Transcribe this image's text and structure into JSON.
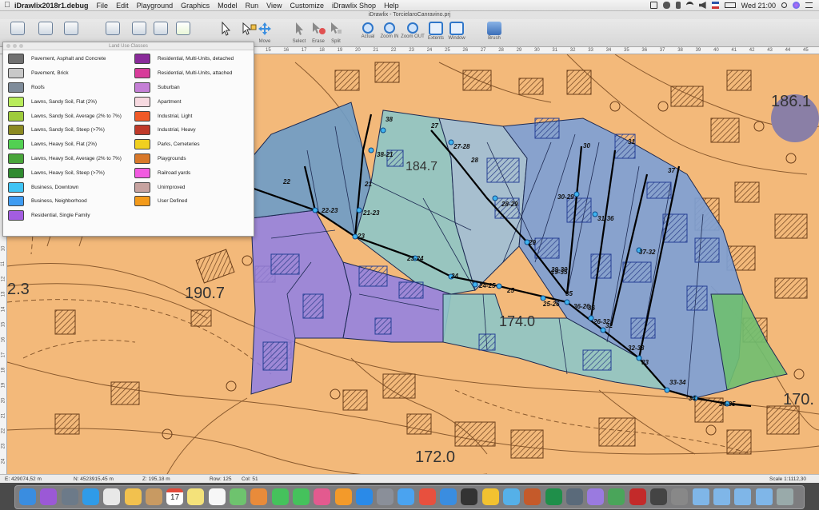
{
  "menubar": {
    "app_name": "iDrawlix2018r1.debug",
    "items": [
      "File",
      "Edit",
      "Playground",
      "Graphics",
      "Model",
      "Run",
      "View",
      "Customize",
      "iDrawlix Shop",
      "Help"
    ],
    "clock": "Wed 21:00"
  },
  "window": {
    "title": "iDrawlix - TorcielaroCanravino.prj"
  },
  "toolbar": {
    "buttons": [
      {
        "label": "",
        "icon": "document-icon"
      },
      {
        "label": "",
        "icon": "document-edit-icon"
      },
      {
        "label": "",
        "icon": "document-list-icon"
      },
      {
        "label": "",
        "icon": "image-icon"
      },
      {
        "label": "",
        "icon": "page-icon"
      },
      {
        "label": "",
        "icon": "page-alt-icon"
      },
      {
        "label": "",
        "icon": "chart-icon"
      },
      {
        "label": "",
        "icon": "pointer-icon"
      },
      {
        "label": "",
        "icon": "add-node-icon"
      },
      {
        "label": "Move",
        "icon": "move-icon"
      },
      {
        "label": "Select",
        "icon": "select-icon"
      },
      {
        "label": "Erase",
        "icon": "erase-icon"
      },
      {
        "label": "Split",
        "icon": "split-icon"
      },
      {
        "label": "Actual",
        "icon": "zoom-actual-icon"
      },
      {
        "label": "Zoom IN",
        "icon": "zoom-in-icon"
      },
      {
        "label": "Zoom OUT",
        "icon": "zoom-out-icon"
      },
      {
        "label": "Extents",
        "icon": "extents-icon"
      },
      {
        "label": "Window",
        "icon": "zoom-window-icon"
      },
      {
        "label": "Brush",
        "icon": "brush-icon"
      }
    ]
  },
  "rulers": {
    "top": [
      "15",
      "16",
      "17",
      "18",
      "19",
      "20",
      "21",
      "22",
      "23",
      "24",
      "25",
      "26",
      "27",
      "28",
      "29",
      "30",
      "31",
      "32",
      "33",
      "34",
      "35",
      "36",
      "37",
      "38",
      "39",
      "40",
      "41",
      "42",
      "43",
      "44",
      "45"
    ],
    "left": [
      "10",
      "11",
      "12",
      "13",
      "14",
      "15",
      "16",
      "17",
      "18",
      "19",
      "20",
      "21",
      "22",
      "23",
      "24",
      "25",
      "26",
      "27"
    ]
  },
  "legend": {
    "title": "Land Use Classes",
    "left_items": [
      {
        "label": "Pavement, Asphalt and Concrete",
        "color": "#707070"
      },
      {
        "label": "Pavement, Brick",
        "color": "#c8c8c8"
      },
      {
        "label": "Roofs",
        "color": "#7f8c9a"
      },
      {
        "label": "Lawns, Sandy Soil, Flat (2%)",
        "color": "#b8ec5a"
      },
      {
        "label": "Lawns, Sandy Soil, Average (2% to 7%)",
        "color": "#9ecb3c"
      },
      {
        "label": "Lawns, Sandy Soil, Steep (>7%)",
        "color": "#8c8a22"
      },
      {
        "label": "Lawns, Heavy Soil, Flat (2%)",
        "color": "#52d052"
      },
      {
        "label": "Lawns, Heavy Soil, Average (2% to 7%)",
        "color": "#49a53a"
      },
      {
        "label": "Lawns, Heavy Soil, Steep (>7%)",
        "color": "#2f8a2f"
      },
      {
        "label": "Business, Downtown",
        "color": "#3fc4f5"
      },
      {
        "label": "Business, Neighborhood",
        "color": "#3f9cf2"
      },
      {
        "label": "Residential, Single Family",
        "color": "#a35de0"
      }
    ],
    "right_items": [
      {
        "label": "Residential, Multi-Units, detached",
        "color": "#8a2a9a"
      },
      {
        "label": "Residential, Multi-Units, attached",
        "color": "#d83c9a"
      },
      {
        "label": "Suburban",
        "color": "#c57fd6"
      },
      {
        "label": "Apartment",
        "color": "#f7d9e0"
      },
      {
        "label": "Industrial, Light",
        "color": "#f05a28"
      },
      {
        "label": "Industrial, Heavy",
        "color": "#c03a2a"
      },
      {
        "label": "Parks, Cemeteries",
        "color": "#f0d020"
      },
      {
        "label": "Playgrounds",
        "color": "#d8782a"
      },
      {
        "label": "Railroad yards",
        "color": "#f25ae0"
      },
      {
        "label": "Unimproved",
        "color": "#c7a3a0"
      },
      {
        "label": "User Defined",
        "color": "#f39a1a"
      }
    ]
  },
  "map": {
    "background_color": "#f3b97a",
    "spot_heights": [
      "186.1",
      "184.7",
      "190.7",
      "174.0",
      "172.0",
      "170.",
      "2.3"
    ],
    "node_labels": [
      "22",
      "22-23",
      "21-23",
      "21",
      "38",
      "38-21",
      "27",
      "27-28",
      "28",
      "23",
      "23-24",
      "24",
      "24-25",
      "25",
      "25-26",
      "29",
      "28-29",
      "29-30",
      "30",
      "30-29",
      "31",
      "31-36",
      "37",
      "37-32",
      "29-35",
      "35",
      "36-26",
      "36",
      "26-32",
      "32",
      "32-33",
      "33",
      "33-34",
      "34",
      "34-35",
      "36-26"
    ]
  },
  "statusbar": {
    "east": "E: 429074,52 m",
    "north": "N: 4523915,45 m",
    "z": "Z: 195,18 m",
    "row": "Row: 125",
    "col": "Col: 51",
    "scale": "Scale 1:1112,30"
  },
  "dock": {
    "calendar_day": "17",
    "icons": [
      "finder-icon",
      "siri-icon",
      "launchpad-icon",
      "safari-icon",
      "app-icon",
      "photos-icon",
      "contacts-icon",
      "calendar-icon",
      "notes-icon",
      "reminders-icon",
      "maps-icon",
      "photos2-icon",
      "messages-icon",
      "facetime-icon",
      "itunes-icon",
      "books-icon",
      "appstore-icon",
      "preferences-icon",
      "help-icon",
      "music-icon",
      "xcode-icon",
      "terminal-icon",
      "chrome-icon",
      "app2-icon",
      "app3-icon",
      "excel-icon",
      "app4-icon",
      "app5-icon",
      "app6-icon",
      "autocad-icon",
      "app7-icon",
      "app8-icon",
      "folder-icon",
      "folder2-icon",
      "folder3-icon",
      "folder4-icon",
      "trash-icon"
    ]
  }
}
